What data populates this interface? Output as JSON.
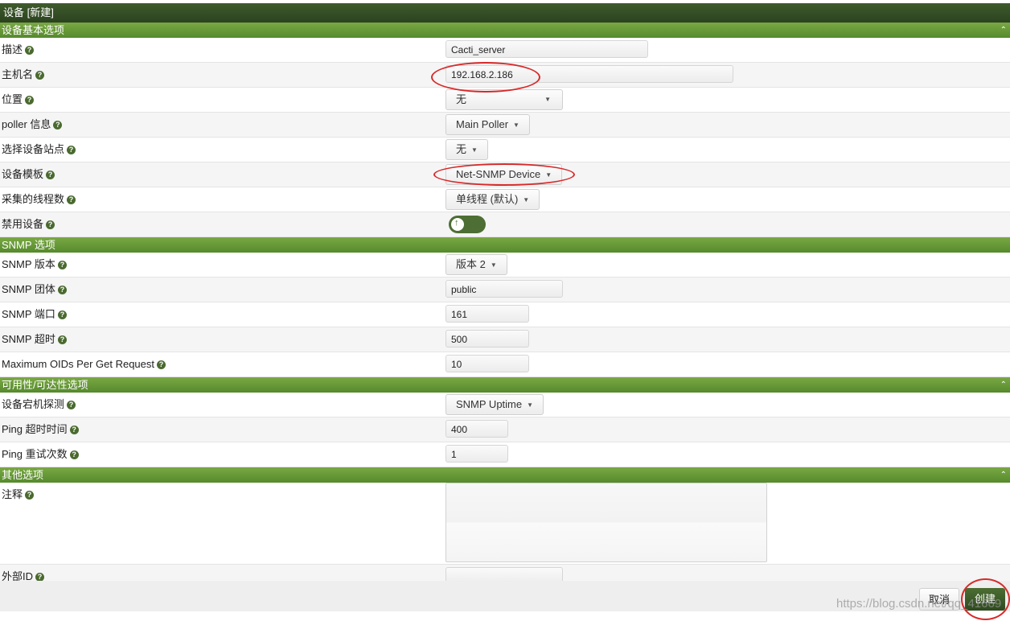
{
  "window": {
    "title": "设备 [新建]"
  },
  "colors": {
    "section_header": "#69983a",
    "title_bar": "#2f4a22",
    "highlight": "#d72a2a"
  },
  "icons": {
    "help": "help-icon",
    "collapse": "collapse-icon"
  },
  "sections": {
    "basic": {
      "title": "设备基本选项",
      "collapse": "⌃"
    },
    "snmp": {
      "title": "SNMP 选项"
    },
    "availability": {
      "title": "可用性/可达性选项",
      "collapse": "⌃"
    },
    "other": {
      "title": "其他选项",
      "collapse": "⌃"
    }
  },
  "fields": {
    "description": {
      "label": "描述",
      "value": "Cacti_server"
    },
    "hostname": {
      "label": "主机名",
      "value": "192.168.2.186"
    },
    "location": {
      "label": "位置",
      "value": "无"
    },
    "poller": {
      "label": "poller 信息",
      "value": "Main Poller"
    },
    "site": {
      "label": "选择设备站点",
      "value": "无"
    },
    "template": {
      "label": "设备模板",
      "value": "Net-SNMP Device"
    },
    "threads": {
      "label": "采集的线程数",
      "value": "单线程 (默认)"
    },
    "disable": {
      "label": "禁用设备",
      "enabled": false
    },
    "snmp_version": {
      "label": "SNMP 版本",
      "value": "版本 2"
    },
    "snmp_community": {
      "label": "SNMP 团体",
      "value": "public"
    },
    "snmp_port": {
      "label": "SNMP 端口",
      "value": "161"
    },
    "snmp_timeout": {
      "label": "SNMP 超时",
      "value": "500"
    },
    "max_oids": {
      "label": "Maximum OIDs Per Get Request",
      "value": "10"
    },
    "downed_detection": {
      "label": "设备宕机探测",
      "value": "SNMP Uptime"
    },
    "ping_timeout": {
      "label": "Ping 超时时间",
      "value": "400"
    },
    "ping_retries": {
      "label": "Ping 重试次数",
      "value": "1"
    },
    "notes": {
      "label": "注释",
      "value": ""
    },
    "external_id": {
      "label": "外部ID",
      "value": ""
    }
  },
  "buttons": {
    "cancel": "取消",
    "create": "创建"
  },
  "watermark": "https://blog.csdn.net/qq_41669"
}
